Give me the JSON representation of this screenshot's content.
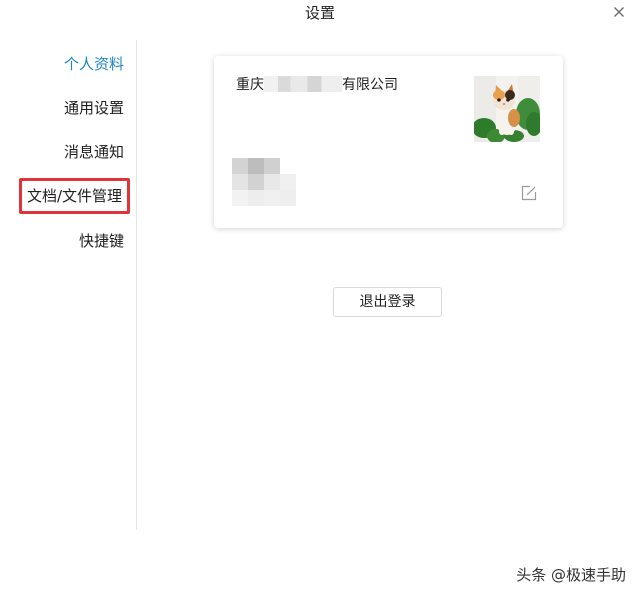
{
  "window": {
    "title": "设置"
  },
  "sidebar": {
    "items": [
      {
        "label": "个人资料",
        "state": "active"
      },
      {
        "label": "通用设置"
      },
      {
        "label": "消息通知"
      },
      {
        "label": "文档/文件管理",
        "state": "highlighted"
      },
      {
        "label": "快捷键"
      }
    ]
  },
  "profile_card": {
    "company_prefix": "重庆",
    "company_suffix": "有限公司",
    "avatar_icon": "cat-photo",
    "edit_icon": "edit-icon"
  },
  "actions": {
    "logout_label": "退出登录"
  },
  "watermark": {
    "text": "头条 @极速手助"
  },
  "colors": {
    "accent": "#1f86c8",
    "highlight_border": "#e0333a",
    "divider": "#e6e6e6"
  }
}
